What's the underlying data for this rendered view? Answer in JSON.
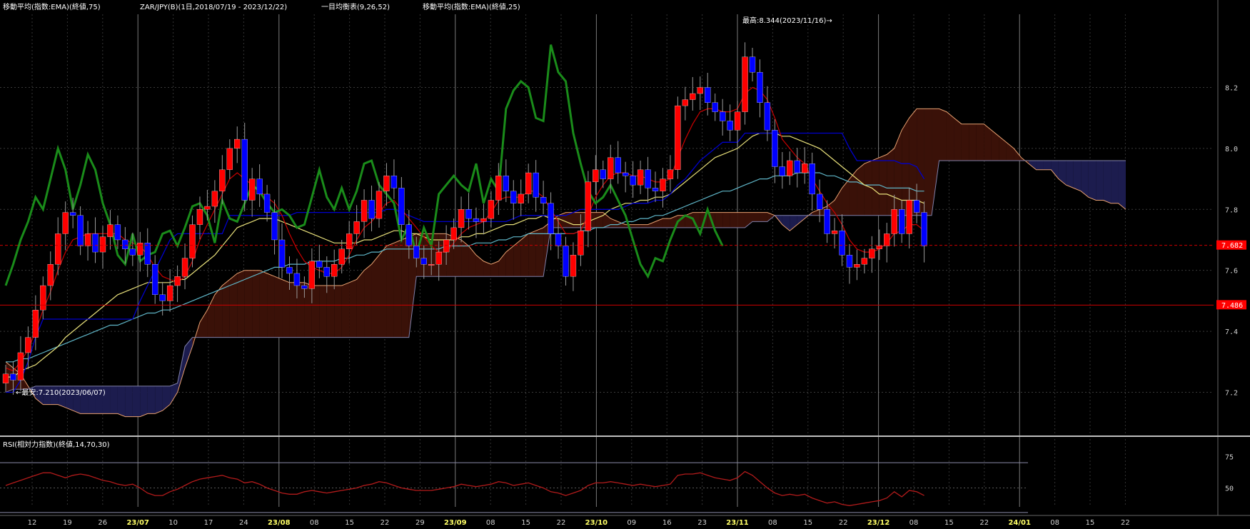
{
  "header": {
    "ema75_label": "移動平均(指数:EMA)(終値,75)",
    "instrument_label": "ZAR/JPY(B)(1日,2018/07/19 - 2023/12/22)",
    "ichimoku_label": "一目均衡表(9,26,52)",
    "ema25_label": "移動平均(指数:EMA)(終値,25)"
  },
  "annotations": {
    "high_label": "最高:8.344(2023/11/16)→",
    "low_label": "←最安:7.210(2023/06/07)"
  },
  "price_tags": {
    "current": "7.682",
    "level": "7.486"
  },
  "rsi": {
    "label": "RSI(相対力指数)(終値,14,70,30)",
    "y_ticks": [
      "75",
      "50"
    ]
  },
  "colors": {
    "up_candle": "#ff0000",
    "down_candle": "#0000ff",
    "ema75": "#5fb6c8",
    "ema25": "#e8e07a",
    "tenkan": "#cc0000",
    "kijun": "#0000cc",
    "chikou": "#1a8c1a",
    "cloud": "#3a1108",
    "cloud_twist": "#1c1c4e",
    "span_a": "#e8a070",
    "span_b": "#8080aa",
    "rsi": "#b21b1b",
    "tag": "#ff0000"
  },
  "chart_data": {
    "type": "candlestick",
    "title": "",
    "y_ticks": [
      "8.2",
      "8.0",
      "7.8",
      "7.6",
      "7.4",
      "7.2"
    ],
    "ylim": [
      7.07,
      8.44
    ],
    "x_ticks": [
      {
        "label": "12",
        "month": false
      },
      {
        "label": "19",
        "month": false
      },
      {
        "label": "26",
        "month": false
      },
      {
        "label": "23/07",
        "month": true
      },
      {
        "label": "10",
        "month": false
      },
      {
        "label": "17",
        "month": false
      },
      {
        "label": "24",
        "month": false
      },
      {
        "label": "23/08",
        "month": true
      },
      {
        "label": "08",
        "month": false
      },
      {
        "label": "15",
        "month": false
      },
      {
        "label": "22",
        "month": false
      },
      {
        "label": "29",
        "month": false
      },
      {
        "label": "23/09",
        "month": true
      },
      {
        "label": "08",
        "month": false
      },
      {
        "label": "15",
        "month": false
      },
      {
        "label": "22",
        "month": false
      },
      {
        "label": "23/10",
        "month": true
      },
      {
        "label": "09",
        "month": false
      },
      {
        "label": "16",
        "month": false
      },
      {
        "label": "23",
        "month": false
      },
      {
        "label": "23/11",
        "month": true
      },
      {
        "label": "08",
        "month": false
      },
      {
        "label": "15",
        "month": false
      },
      {
        "label": "22",
        "month": false
      },
      {
        "label": "23/12",
        "month": true
      },
      {
        "label": "08",
        "month": false
      },
      {
        "label": "15",
        "month": false
      },
      {
        "label": "22",
        "month": false
      },
      {
        "label": "24/01",
        "month": true
      },
      {
        "label": "08",
        "month": false
      },
      {
        "label": "15",
        "month": false
      },
      {
        "label": "22",
        "month": false
      }
    ],
    "closes": [
      7.26,
      7.24,
      7.33,
      7.38,
      7.47,
      7.55,
      7.62,
      7.72,
      7.79,
      7.78,
      7.68,
      7.72,
      7.66,
      7.71,
      7.75,
      7.7,
      7.67,
      7.65,
      7.69,
      7.62,
      7.52,
      7.5,
      7.55,
      7.58,
      7.64,
      7.75,
      7.8,
      7.81,
      7.86,
      7.93,
      8.0,
      8.03,
      7.83,
      7.9,
      7.85,
      7.79,
      7.7,
      7.61,
      7.59,
      7.55,
      7.54,
      7.63,
      7.61,
      7.58,
      7.62,
      7.67,
      7.72,
      7.76,
      7.83,
      7.77,
      7.86,
      7.91,
      7.87,
      7.75,
      7.68,
      7.64,
      7.62,
      7.62,
      7.66,
      7.7,
      7.74,
      7.8,
      7.77,
      7.76,
      7.77,
      7.83,
      7.91,
      7.86,
      7.82,
      7.85,
      7.92,
      7.84,
      7.82,
      7.72,
      7.68,
      7.58,
      7.65,
      7.73,
      7.89,
      7.93,
      7.9,
      7.97,
      7.92,
      7.91,
      7.88,
      7.93,
      7.87,
      7.86,
      7.9,
      7.93,
      8.14,
      8.16,
      8.18,
      8.2,
      8.15,
      8.12,
      8.09,
      8.06,
      8.12,
      8.3,
      8.25,
      8.15,
      8.06,
      7.94,
      7.91,
      7.96,
      7.92,
      7.95,
      7.85,
      7.8,
      7.72,
      7.73,
      7.65,
      7.61,
      7.62,
      7.64,
      7.67,
      7.68,
      7.72,
      7.8,
      7.72,
      7.83,
      7.79,
      7.68
    ],
    "ema25": [
      7.25,
      7.25,
      7.27,
      7.28,
      7.29,
      7.31,
      7.33,
      7.35,
      7.38,
      7.4,
      7.42,
      7.44,
      7.46,
      7.48,
      7.5,
      7.52,
      7.53,
      7.54,
      7.55,
      7.56,
      7.56,
      7.56,
      7.56,
      7.57,
      7.57,
      7.59,
      7.61,
      7.63,
      7.65,
      7.68,
      7.71,
      7.74,
      7.75,
      7.76,
      7.77,
      7.77,
      7.77,
      7.76,
      7.75,
      7.74,
      7.73,
      7.72,
      7.71,
      7.7,
      7.69,
      7.69,
      7.69,
      7.69,
      7.7,
      7.7,
      7.71,
      7.72,
      7.73,
      7.73,
      7.72,
      7.72,
      7.71,
      7.7,
      7.7,
      7.7,
      7.7,
      7.71,
      7.71,
      7.72,
      7.72,
      7.73,
      7.74,
      7.75,
      7.75,
      7.76,
      7.77,
      7.77,
      7.78,
      7.77,
      7.77,
      7.76,
      7.75,
      7.75,
      7.76,
      7.77,
      7.78,
      7.8,
      7.81,
      7.82,
      7.82,
      7.83,
      7.83,
      7.84,
      7.84,
      7.85,
      7.87,
      7.89,
      7.91,
      7.93,
      7.95,
      7.97,
      7.98,
      7.99,
      8.0,
      8.02,
      8.04,
      8.05,
      8.05,
      8.05,
      8.04,
      8.04,
      8.03,
      8.02,
      8.01,
      8.0,
      7.98,
      7.96,
      7.94,
      7.92,
      7.9,
      7.88,
      7.87,
      7.85,
      7.85,
      7.84,
      7.83,
      7.83,
      7.83,
      7.82
    ],
    "ema75": [
      7.3,
      7.3,
      7.31,
      7.31,
      7.32,
      7.33,
      7.34,
      7.35,
      7.36,
      7.37,
      7.38,
      7.39,
      7.4,
      7.41,
      7.42,
      7.42,
      7.43,
      7.44,
      7.45,
      7.46,
      7.46,
      7.47,
      7.47,
      7.48,
      7.49,
      7.5,
      7.51,
      7.52,
      7.53,
      7.54,
      7.55,
      7.56,
      7.57,
      7.58,
      7.59,
      7.6,
      7.61,
      7.61,
      7.62,
      7.62,
      7.62,
      7.63,
      7.63,
      7.63,
      7.63,
      7.64,
      7.64,
      7.65,
      7.65,
      7.66,
      7.66,
      7.67,
      7.67,
      7.67,
      7.67,
      7.67,
      7.67,
      7.67,
      7.67,
      7.68,
      7.68,
      7.68,
      7.68,
      7.69,
      7.69,
      7.69,
      7.7,
      7.7,
      7.71,
      7.71,
      7.72,
      7.72,
      7.72,
      7.72,
      7.72,
      7.72,
      7.72,
      7.73,
      7.73,
      7.74,
      7.74,
      7.75,
      7.75,
      7.76,
      7.76,
      7.77,
      7.77,
      7.78,
      7.78,
      7.79,
      7.8,
      7.81,
      7.82,
      7.83,
      7.84,
      7.85,
      7.86,
      7.86,
      7.87,
      7.88,
      7.89,
      7.9,
      7.9,
      7.91,
      7.91,
      7.91,
      7.92,
      7.92,
      7.92,
      7.92,
      7.91,
      7.91,
      7.9,
      7.89,
      7.89,
      7.88,
      7.88,
      7.88,
      7.87,
      7.87,
      7.87,
      7.87,
      7.86,
      7.86
    ],
    "tenkan": [
      7.28,
      7.27,
      7.3,
      7.34,
      7.4,
      7.47,
      7.53,
      7.6,
      7.66,
      7.7,
      7.71,
      7.72,
      7.72,
      7.72,
      7.72,
      7.72,
      7.7,
      7.69,
      7.68,
      7.65,
      7.61,
      7.58,
      7.57,
      7.56,
      7.58,
      7.63,
      7.7,
      7.75,
      7.8,
      7.85,
      7.9,
      7.92,
      7.9,
      7.88,
      7.86,
      7.84,
      7.82,
      7.78,
      7.72,
      7.67,
      7.63,
      7.61,
      7.6,
      7.59,
      7.59,
      7.61,
      7.65,
      7.7,
      7.74,
      7.76,
      7.79,
      7.82,
      7.83,
      7.8,
      7.77,
      7.74,
      7.71,
      7.68,
      7.66,
      7.66,
      7.69,
      7.72,
      7.74,
      7.75,
      7.76,
      7.79,
      7.83,
      7.84,
      7.84,
      7.84,
      7.86,
      7.86,
      7.84,
      7.8,
      7.76,
      7.72,
      7.72,
      7.73,
      7.78,
      7.84,
      7.88,
      7.91,
      7.92,
      7.92,
      7.91,
      7.91,
      7.9,
      7.89,
      7.89,
      7.9,
      7.97,
      8.03,
      8.08,
      8.12,
      8.13,
      8.13,
      8.12,
      8.12,
      8.13,
      8.18,
      8.2,
      8.19,
      8.16,
      8.1,
      8.03,
      8.0,
      7.97,
      7.95,
      7.9,
      7.86,
      7.82,
      7.79,
      7.75,
      7.7,
      7.67,
      7.66,
      7.66,
      7.67,
      7.69,
      7.72,
      7.73,
      7.75,
      7.75,
      7.73
    ],
    "kijun": [
      7.2,
      7.2,
      7.24,
      7.3,
      7.38,
      7.44,
      7.44,
      7.44,
      7.44,
      7.44,
      7.44,
      7.44,
      7.44,
      7.44,
      7.44,
      7.44,
      7.44,
      7.44,
      7.5,
      7.55,
      7.6,
      7.65,
      7.7,
      7.72,
      7.72,
      7.72,
      7.72,
      7.72,
      7.72,
      7.72,
      7.78,
      7.78,
      7.78,
      7.78,
      7.78,
      7.78,
      7.78,
      7.78,
      7.78,
      7.79,
      7.79,
      7.79,
      7.79,
      7.79,
      7.79,
      7.79,
      7.79,
      7.79,
      7.79,
      7.79,
      7.79,
      7.8,
      7.8,
      7.79,
      7.78,
      7.77,
      7.76,
      7.76,
      7.76,
      7.76,
      7.76,
      7.76,
      7.76,
      7.76,
      7.76,
      7.76,
      7.76,
      7.76,
      7.77,
      7.78,
      7.78,
      7.78,
      7.78,
      7.78,
      7.78,
      7.78,
      7.79,
      7.8,
      7.8,
      7.8,
      7.8,
      7.8,
      7.8,
      7.81,
      7.82,
      7.82,
      7.82,
      7.83,
      7.83,
      7.85,
      7.88,
      7.9,
      7.93,
      7.96,
      7.98,
      8.0,
      8.02,
      8.02,
      8.02,
      8.05,
      8.05,
      8.05,
      8.05,
      8.05,
      8.05,
      8.05,
      8.05,
      8.05,
      8.05,
      8.05,
      8.05,
      8.05,
      8.05,
      8.0,
      7.96,
      7.96,
      7.96,
      7.96,
      7.96,
      7.96,
      7.95,
      7.95,
      7.94,
      7.9
    ],
    "chikou": [
      7.55,
      7.62,
      7.7,
      7.76,
      7.84,
      7.8,
      7.9,
      8.0,
      7.93,
      7.8,
      7.88,
      7.98,
      7.93,
      7.82,
      7.75,
      7.65,
      7.62,
      7.72,
      7.63,
      7.65,
      7.66,
      7.72,
      7.73,
      7.68,
      7.74,
      7.81,
      7.82,
      7.78,
      7.69,
      7.83,
      7.77,
      7.76,
      7.82,
      7.88,
      7.86,
      7.82,
      7.79,
      7.8,
      7.78,
      7.74,
      7.75,
      7.84,
      7.93,
      7.84,
      7.8,
      7.87,
      7.8,
      7.86,
      7.95,
      7.96,
      7.88,
      7.85,
      7.82,
      7.7,
      7.75,
      7.65,
      7.74,
      7.68,
      7.85,
      7.88,
      7.91,
      7.88,
      7.86,
      7.95,
      7.82,
      7.9,
      7.86,
      8.13,
      8.19,
      8.22,
      8.2,
      8.1,
      8.09,
      8.34,
      8.25,
      8.22,
      8.05,
      7.95,
      7.86,
      7.82,
      7.84,
      7.88,
      7.83,
      7.78,
      7.7,
      7.62,
      7.58,
      7.64,
      7.63,
      7.7,
      7.76,
      7.78,
      7.77,
      7.72,
      7.8,
      7.73,
      7.68
    ],
    "span_a": [
      7.3,
      7.28,
      7.26,
      7.22,
      7.18,
      7.16,
      7.16,
      7.16,
      7.15,
      7.14,
      7.13,
      7.13,
      7.13,
      7.13,
      7.13,
      7.13,
      7.12,
      7.12,
      7.12,
      7.13,
      7.13,
      7.14,
      7.16,
      7.2,
      7.28,
      7.35,
      7.43,
      7.47,
      7.52,
      7.55,
      7.57,
      7.59,
      7.6,
      7.6,
      7.6,
      7.59,
      7.58,
      7.57,
      7.56,
      7.56,
      7.56,
      7.55,
      7.55,
      7.55,
      7.55,
      7.55,
      7.56,
      7.57,
      7.6,
      7.62,
      7.65,
      7.68,
      7.69,
      7.7,
      7.71,
      7.72,
      7.72,
      7.72,
      7.72,
      7.72,
      7.71,
      7.7,
      7.68,
      7.65,
      7.63,
      7.62,
      7.63,
      7.66,
      7.68,
      7.7,
      7.72,
      7.73,
      7.74,
      7.76,
      7.78,
      7.79,
      7.79,
      7.79,
      7.79,
      7.79,
      7.79,
      7.77,
      7.76,
      7.75,
      7.75,
      7.75,
      7.75,
      7.76,
      7.77,
      7.77,
      7.78,
      7.78,
      7.79,
      7.79,
      7.79,
      7.79,
      7.79,
      7.79,
      7.79,
      7.79,
      7.79,
      7.79,
      7.79,
      7.78,
      7.75,
      7.73,
      7.75,
      7.77,
      7.79,
      7.8,
      7.81,
      7.83,
      7.87,
      7.9,
      7.93,
      7.95,
      7.96,
      7.97,
      7.98,
      8.0,
      8.06,
      8.1,
      8.13,
      8.13,
      8.13,
      8.13,
      8.12,
      8.1,
      8.08,
      8.08,
      8.08,
      8.08,
      8.06,
      8.04,
      8.02,
      8.0,
      7.97,
      7.95,
      7.93,
      7.93,
      7.93,
      7.9,
      7.88,
      7.87,
      7.86,
      7.84,
      7.83,
      7.83,
      7.82,
      7.82,
      7.8
    ],
    "span_b": [
      7.2,
      7.21,
      7.21,
      7.21,
      7.22,
      7.22,
      7.22,
      7.22,
      7.22,
      7.22,
      7.22,
      7.22,
      7.22,
      7.22,
      7.22,
      7.22,
      7.22,
      7.22,
      7.22,
      7.22,
      7.22,
      7.22,
      7.22,
      7.23,
      7.35,
      7.38,
      7.38,
      7.38,
      7.38,
      7.38,
      7.38,
      7.38,
      7.38,
      7.38,
      7.38,
      7.38,
      7.38,
      7.38,
      7.38,
      7.38,
      7.38,
      7.38,
      7.38,
      7.38,
      7.38,
      7.38,
      7.38,
      7.38,
      7.38,
      7.38,
      7.38,
      7.38,
      7.38,
      7.38,
      7.38,
      7.58,
      7.58,
      7.58,
      7.58,
      7.58,
      7.58,
      7.58,
      7.58,
      7.58,
      7.58,
      7.58,
      7.58,
      7.58,
      7.58,
      7.58,
      7.58,
      7.58,
      7.58,
      7.74,
      7.74,
      7.74,
      7.74,
      7.74,
      7.74,
      7.74,
      7.74,
      7.74,
      7.74,
      7.74,
      7.74,
      7.74,
      7.74,
      7.74,
      7.74,
      7.74,
      7.74,
      7.74,
      7.74,
      7.74,
      7.74,
      7.74,
      7.74,
      7.74,
      7.74,
      7.74,
      7.76,
      7.76,
      7.76,
      7.78,
      7.78,
      7.78,
      7.78,
      7.78,
      7.78,
      7.78,
      7.78,
      7.78,
      7.78,
      7.78,
      7.78,
      7.78,
      7.78,
      7.78,
      7.78,
      7.78,
      7.78,
      7.78,
      7.78,
      7.78,
      7.78,
      7.96,
      7.96,
      7.96,
      7.96,
      7.96,
      7.96,
      7.96,
      7.96,
      7.96,
      7.96,
      7.96,
      7.96,
      7.96,
      7.96,
      7.96,
      7.96,
      7.96,
      7.96,
      7.96,
      7.96,
      7.96,
      7.96,
      7.96,
      7.96,
      7.96,
      7.96
    ],
    "rsi_values": [
      52,
      54,
      56,
      58,
      60,
      62,
      62,
      60,
      58,
      60,
      61,
      60,
      58,
      56,
      55,
      53,
      52,
      53,
      50,
      46,
      44,
      44,
      47,
      49,
      52,
      55,
      57,
      58,
      59,
      60,
      58,
      57,
      54,
      55,
      53,
      50,
      48,
      46,
      45,
      45,
      47,
      48,
      47,
      46,
      47,
      48,
      49,
      50,
      52,
      53,
      55,
      54,
      52,
      50,
      49,
      48,
      48,
      48,
      49,
      50,
      51,
      53,
      52,
      51,
      52,
      53,
      55,
      54,
      52,
      53,
      54,
      52,
      50,
      47,
      46,
      44,
      46,
      48,
      52,
      54,
      54,
      55,
      54,
      53,
      52,
      53,
      52,
      51,
      52,
      53,
      60,
      61,
      61,
      62,
      60,
      58,
      57,
      56,
      58,
      63,
      60,
      55,
      50,
      46,
      44,
      45,
      44,
      45,
      42,
      40,
      38,
      39,
      37,
      36,
      37,
      38,
      39,
      40,
      42,
      47,
      43,
      48,
      47,
      44
    ]
  }
}
